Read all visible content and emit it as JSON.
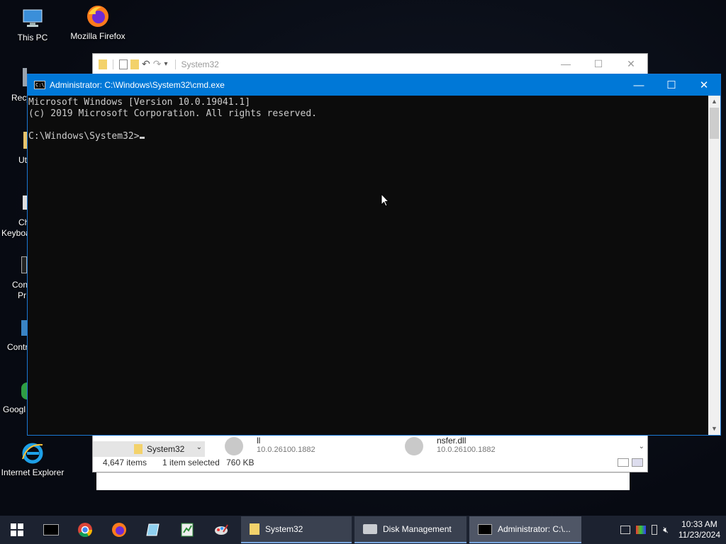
{
  "desktop": {
    "icons": [
      {
        "label": "This PC",
        "icon": "pc-icon"
      },
      {
        "label": "Mozilla Firefox",
        "icon": "firefox-icon"
      },
      {
        "label": "Internet Explorer",
        "icon": "ie-icon"
      }
    ],
    "partial_labels": [
      "Recy",
      "Ut",
      "Ch",
      "Keyboa",
      "Con",
      "Pr",
      "Contr",
      "Googl"
    ]
  },
  "explorer": {
    "title": "System32",
    "nav_item": "System32",
    "files": [
      {
        "name": "ll",
        "version": "10.0.26100.1882"
      },
      {
        "name": "nsfer.dll",
        "version": "10.0.26100.1882"
      }
    ],
    "status": {
      "items": "4,647 items",
      "selected": "1 item selected",
      "size": "760 KB"
    }
  },
  "cmd": {
    "title": "Administrator: C:\\Windows\\System32\\cmd.exe",
    "lines": [
      "Microsoft Windows [Version 10.0.19041.1]",
      "(c) 2019 Microsoft Corporation. All rights reserved.",
      "",
      "C:\\Windows\\System32>"
    ]
  },
  "taskbar": {
    "pinned": [
      "cmd-icon",
      "chrome-icon",
      "firefox-icon",
      "notepad-icon",
      "spreadsheet-icon",
      "paint-icon"
    ],
    "apps": [
      {
        "label": "System32",
        "icon": "folder-icon"
      },
      {
        "label": "Disk Management",
        "icon": "disk-icon"
      },
      {
        "label": "Administrator: C:\\...",
        "icon": "cmd-icon"
      }
    ],
    "clock": {
      "time": "10:33 AM",
      "date": "11/23/2024"
    }
  }
}
